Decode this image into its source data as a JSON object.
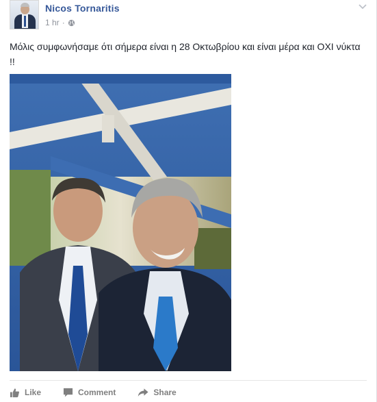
{
  "post": {
    "author": "Nicos Tornaritis",
    "time": "1 hr",
    "separator": "·",
    "audience_icon": "globe-icon",
    "menu_icon": "chevron-down-icon",
    "text": "Μόλις συμφωνήσαμε ότι σήμερα είναι η 28 Οκτωβρίου και είναι μέρα και ΟΧΙ νύκτα !!"
  },
  "actions": {
    "like": "Like",
    "comment": "Comment",
    "share": "Share"
  },
  "colors": {
    "author_link": "#365899",
    "meta_text": "#90949c",
    "action_text": "#7f7f7f",
    "canopy_blue": "#2f5fa8"
  }
}
